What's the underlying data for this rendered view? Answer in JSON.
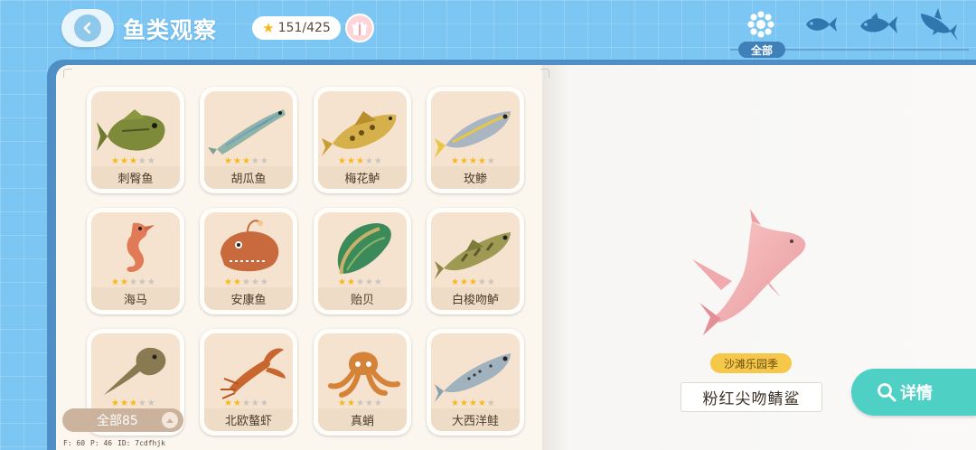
{
  "header": {
    "title": "鱼类观察",
    "progress": "151/425",
    "back_icon": "back-arrow-icon",
    "gift_icon": "gift-icon"
  },
  "filters": {
    "selected_label": "全部",
    "tabs": [
      {
        "icon": "all-grid-icon"
      },
      {
        "icon": "small-fish-icon"
      },
      {
        "icon": "medium-fish-icon"
      },
      {
        "icon": "large-fish-icon"
      }
    ]
  },
  "fish_cards": [
    {
      "name": "刺臀鱼",
      "stars": 3,
      "max": 5
    },
    {
      "name": "胡瓜鱼",
      "stars": 3,
      "max": 5
    },
    {
      "name": "梅花鲈",
      "stars": 3,
      "max": 5
    },
    {
      "name": "玫鲹",
      "stars": 4,
      "max": 5
    },
    {
      "name": "海马",
      "stars": 2,
      "max": 5
    },
    {
      "name": "安康鱼",
      "stars": 2,
      "max": 5
    },
    {
      "name": "贻贝",
      "stars": 2,
      "max": 5
    },
    {
      "name": "白梭吻鲈",
      "stars": 3,
      "max": 5
    },
    {
      "name": "",
      "stars": 3,
      "max": 5
    },
    {
      "name": "北欧螯虾",
      "stars": 2,
      "max": 5
    },
    {
      "name": "真蛸",
      "stars": 2,
      "max": 5
    },
    {
      "name": "大西洋鲑",
      "stars": 4,
      "max": 5
    }
  ],
  "filter_pill": {
    "label": "全部85"
  },
  "debug": {
    "f": "F: 60",
    "p": "P: 46",
    "id": "ID: 7cdfhjk"
  },
  "detail": {
    "season": "沙滩乐园季",
    "fish_name": "粉红尖吻鲭鲨",
    "button_label": "详情"
  },
  "colors": {
    "background": "#7cc6f4",
    "book_edge": "#4f8fc6",
    "page": "#fbf7ef",
    "accent_button": "#4fd0c5",
    "season_tag": "#f5c84a",
    "star_on": "#f6b81a"
  }
}
